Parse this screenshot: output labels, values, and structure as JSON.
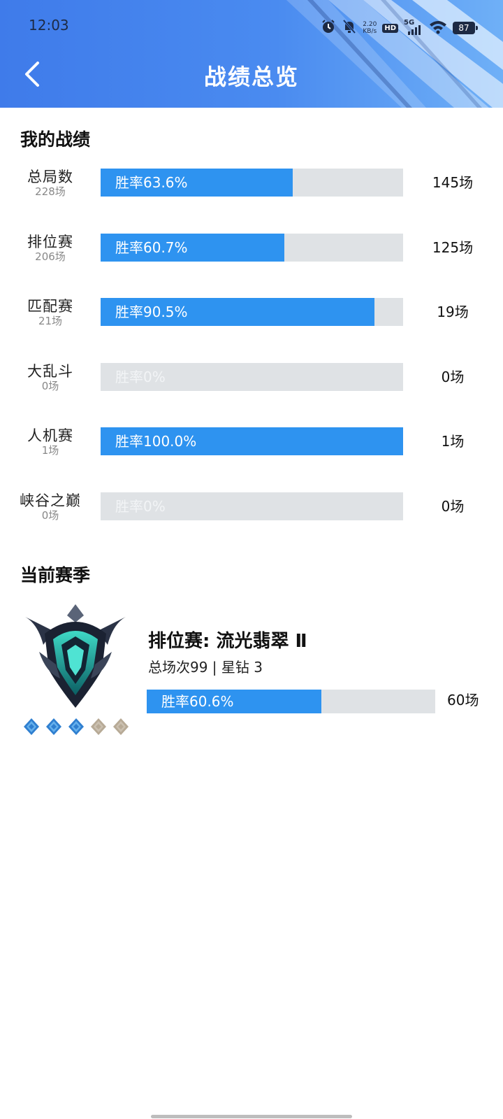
{
  "status_bar": {
    "time": "12:03",
    "net_speed_value": "2.20",
    "net_speed_unit": "KB/s",
    "hd_label": "HD",
    "network_label": "5G",
    "battery_level": "87",
    "icons": [
      "alarm-icon",
      "mute-icon",
      "signal-icon",
      "wifi-icon",
      "battery-icon"
    ]
  },
  "header": {
    "title": "战绩总览",
    "back_icon": "chevron-left-icon"
  },
  "my_record": {
    "title": "我的战绩",
    "rows": [
      {
        "name": "总局数",
        "games": "228场",
        "win_rate_label": "胜率63.6%",
        "win_rate": 63.6,
        "wins": "145场"
      },
      {
        "name": "排位赛",
        "games": "206场",
        "win_rate_label": "胜率60.7%",
        "win_rate": 60.7,
        "wins": "125场"
      },
      {
        "name": "匹配赛",
        "games": "21场",
        "win_rate_label": "胜率90.5%",
        "win_rate": 90.5,
        "wins": "19场"
      },
      {
        "name": "大乱斗",
        "games": "0场",
        "win_rate_label": "胜率0%",
        "win_rate": 0,
        "wins": "0场"
      },
      {
        "name": "人机赛",
        "games": "1场",
        "win_rate_label": "胜率100.0%",
        "win_rate": 100.0,
        "wins": "1场"
      },
      {
        "name": "峡谷之巅",
        "games": "0场",
        "win_rate_label": "胜率0%",
        "win_rate": 0,
        "wins": "0场"
      }
    ]
  },
  "season": {
    "title": "当前赛季",
    "rank": "排位赛: 流光翡翠 Ⅱ",
    "info": "总场次99 | 星钻 3",
    "win_rate_label": "胜率60.6%",
    "win_rate": 60.6,
    "wins": "60场",
    "stars_filled": 3,
    "stars_total": 5,
    "emblem_icon": "emerald-rank-emblem-icon"
  },
  "colors": {
    "header_start": "#3f7bea",
    "header_end": "#6fb0f7",
    "bar_fill": "#2e93f0",
    "bar_track": "#dfe2e5",
    "pip_filled": "#2f7fd0",
    "pip_empty": "#b7aa96"
  }
}
